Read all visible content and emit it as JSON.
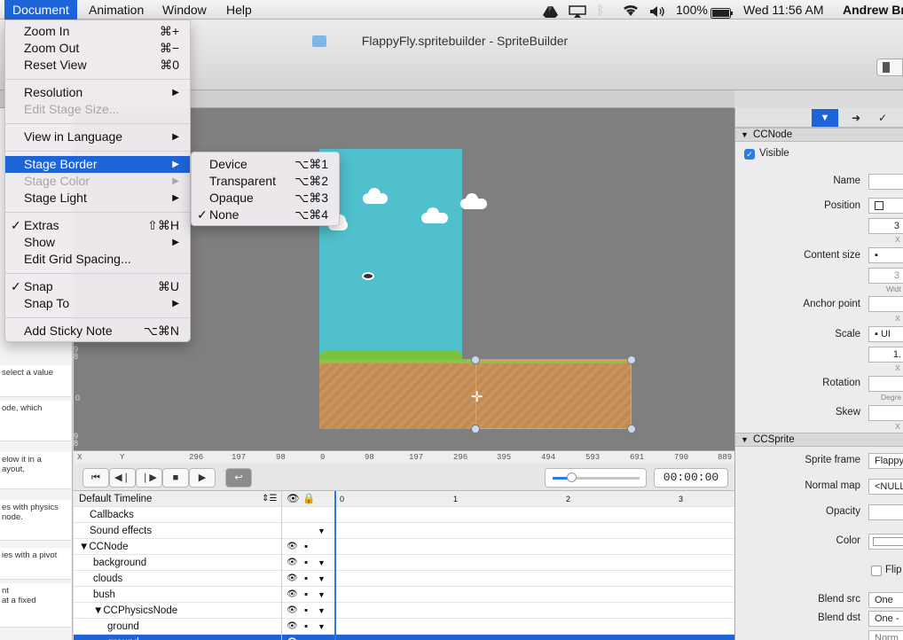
{
  "menubar": {
    "items": [
      "Document",
      "Animation",
      "Window",
      "Help"
    ],
    "battery": "100%",
    "clock": "Wed 11:56 AM",
    "user": "Andrew Br"
  },
  "window": {
    "title": "FlappyFly.spritebuilder - SpriteBuilder"
  },
  "doc_menu": {
    "zoom_in": "Zoom In",
    "zoom_in_sc": "⌘+",
    "zoom_out": "Zoom Out",
    "zoom_out_sc": "⌘−",
    "reset_view": "Reset View",
    "reset_view_sc": "⌘0",
    "resolution": "Resolution",
    "edit_stage_size": "Edit Stage Size...",
    "view_in_language": "View in Language",
    "stage_border": "Stage Border",
    "stage_color": "Stage Color",
    "stage_light": "Stage Light",
    "extras": "Extras",
    "extras_sc": "⇧⌘H",
    "show": "Show",
    "edit_grid_spacing": "Edit Grid Spacing...",
    "snap": "Snap",
    "snap_sc": "⌘U",
    "snap_to": "Snap To",
    "add_sticky_note": "Add Sticky Note",
    "add_sticky_note_sc": "⌥⌘N"
  },
  "border_submenu": {
    "device": "Device",
    "device_sc": "⌥⌘1",
    "transparent": "Transparent",
    "transparent_sc": "⌥⌘2",
    "opaque": "Opaque",
    "opaque_sc": "⌥⌘3",
    "none": "None",
    "none_sc": "⌥⌘4",
    "checked": "None"
  },
  "left_panel": {
    "cards": [
      "select a value",
      "ode, which",
      "elow it in a\nayout.",
      "es with physics\nnode.",
      "ies with a pivot",
      "nt\nat a fixed"
    ]
  },
  "rulers": {
    "h_ticks": [
      "X",
      "Y",
      "296",
      "197",
      "98",
      "0",
      "98",
      "197",
      "296",
      "395",
      "494",
      "593",
      "691",
      "790",
      "889"
    ],
    "v_ticks": [
      "9\n8",
      "0",
      "9\n8"
    ]
  },
  "timeline": {
    "timecode": "00:00:00",
    "name": "Default Timeline",
    "scale_labels": [
      "0",
      "1",
      "2",
      "3"
    ],
    "rows": [
      {
        "label": "Callbacks",
        "indent": 0,
        "toggle": ""
      },
      {
        "label": "Sound effects",
        "indent": 0,
        "toggle": ""
      },
      {
        "label": "CCNode",
        "indent": 0,
        "toggle": "▼"
      },
      {
        "label": "background",
        "indent": 1,
        "toggle": ""
      },
      {
        "label": "clouds",
        "indent": 1,
        "toggle": ""
      },
      {
        "label": "bush",
        "indent": 1,
        "toggle": ""
      },
      {
        "label": "CCPhysicsNode",
        "indent": 1,
        "toggle": "▼"
      },
      {
        "label": "ground",
        "indent": 2,
        "toggle": ""
      },
      {
        "label": "ground",
        "indent": 2,
        "toggle": "",
        "selected": true
      }
    ]
  },
  "inspector": {
    "ccnode_header": "CCNode",
    "visible": "Visible",
    "name_label": "Name",
    "position_label": "Position",
    "position_value": "3",
    "position_x": "X",
    "content_size_label": "Content size",
    "content_size_value": "3",
    "content_size_sub": "Widt",
    "anchor_label": "Anchor point",
    "anchor_sub": "X",
    "scale_label": "Scale",
    "scale_mode": "UI",
    "scale_value": "1.",
    "scale_sub": "X",
    "rotation_label": "Rotation",
    "rotation_sub": "Degre",
    "skew_label": "Skew",
    "skew_sub": "X",
    "ccsprite_header": "CCSprite",
    "sprite_frame_label": "Sprite frame",
    "sprite_frame_value": "Flappy",
    "normal_map_label": "Normal map",
    "normal_map_value": "<NULL",
    "opacity_label": "Opacity",
    "color_label": "Color",
    "flip_label": "Flip",
    "blend_src_label": "Blend src",
    "blend_src_value": "One",
    "blend_dst_label": "Blend dst",
    "blend_dst_value": "One -",
    "bottom_value": "Norm"
  },
  "colors": {
    "accent": "#1d64d8",
    "sky": "#4fc0cc",
    "stage_bg": "#7f7f7f"
  }
}
